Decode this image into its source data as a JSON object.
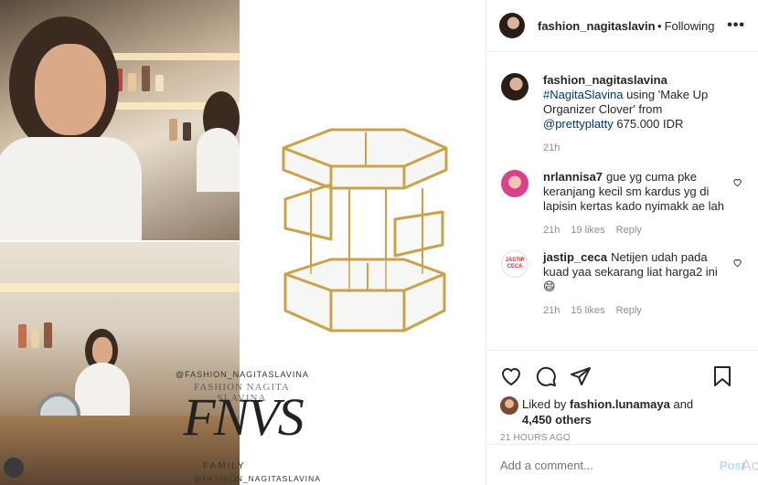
{
  "media": {
    "watermark": {
      "top_text": "@FASHION_NAGITASLAVINA",
      "sub_text": "FASHION NAGITA SLAVINA",
      "logo": "FNVS",
      "family": "FAMILY",
      "bottom_text": "@FASHION_NAGITASLAVINA"
    }
  },
  "header": {
    "username": "fashion_nagitaslavina",
    "dot": "•",
    "follow_label": "Following",
    "more_icon": "more-horizontal-icon",
    "more_label": "•••"
  },
  "caption": {
    "username": "fashion_nagitaslavina",
    "hashtag": "#NagitaSlavina",
    "text1": " using 'Make Up Organizer Clover' from ",
    "mention": "@prettyplatty",
    "text2": " 675.000 IDR",
    "time": "21h"
  },
  "comments": [
    {
      "username": "nrlannisa7",
      "text": "gue yg cuma pke keranjang kecil sm kardus yg di lapisin kertas kado nyimakk ae lah",
      "time": "21h",
      "likes": "19 likes",
      "reply": "Reply"
    },
    {
      "username": "jastip_ceca",
      "text": "Netijen udah pada kuad yaa sekarang liat harga2 ini 😄",
      "time": "21h",
      "likes": "15 likes",
      "reply": "Reply",
      "avatar_text": "JASTIP CECA"
    }
  ],
  "actions": {
    "liked_by_prefix": "Liked by ",
    "liked_by_user": "fashion.lunamaya",
    "liked_by_and": " and",
    "others": "4,450 others",
    "timestamp": "21 HOURS AGO"
  },
  "add_comment": {
    "placeholder": "Add a comment...",
    "post_label": "Post",
    "overlay": "Act"
  },
  "colors": {
    "link": "#00376b",
    "muted": "#8e8e8e",
    "post_disabled": "#b2dffc",
    "gold": "#c9a24a"
  }
}
